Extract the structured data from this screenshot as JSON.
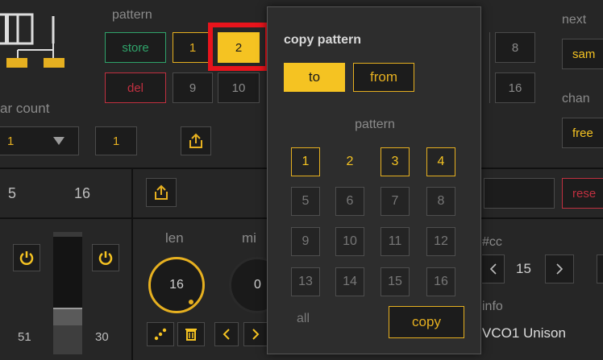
{
  "pattern_panel": {
    "title": "pattern",
    "store_label": "store",
    "del_label": "del",
    "slot_row1": [
      "1",
      "2"
    ],
    "slot_row2": [
      "9",
      "10"
    ],
    "slot_right_row1": "8",
    "slot_right_row2": "16",
    "selected_slot": "2"
  },
  "bar_count": {
    "label": "ar count",
    "dropdown_value": "1",
    "field_value": "1"
  },
  "range_row": {
    "start": "5",
    "end": "16"
  },
  "slider": {
    "left_value": "51",
    "right_value": "30"
  },
  "knobs": {
    "len_label": "len",
    "len_value": "16",
    "min_label": "mi",
    "min_value": "0"
  },
  "right_panel": {
    "next_label": "next",
    "next_value": "sam",
    "chan_label": "chan",
    "chan_value": "free",
    "reset_label": "rese",
    "cc_label": "#cc",
    "cc_value": "15",
    "info_label": "info",
    "info_value": "VCO1 Unison"
  },
  "copy_popup": {
    "title": "copy pattern",
    "to_label": "to",
    "from_label": "from",
    "pattern_label": "pattern",
    "grid": [
      [
        "1",
        "2",
        "3",
        "4"
      ],
      [
        "5",
        "6",
        "7",
        "8"
      ],
      [
        "9",
        "10",
        "11",
        "12"
      ],
      [
        "13",
        "14",
        "15",
        "16"
      ]
    ],
    "selected": [
      "1",
      "3",
      "4"
    ],
    "current": "2",
    "all_label": "all",
    "copy_label": "copy"
  },
  "colors": {
    "accent": "#f5c322",
    "store_green": "#2fa36a",
    "del_red": "#c03040",
    "highlight_red": "#e8141c"
  }
}
